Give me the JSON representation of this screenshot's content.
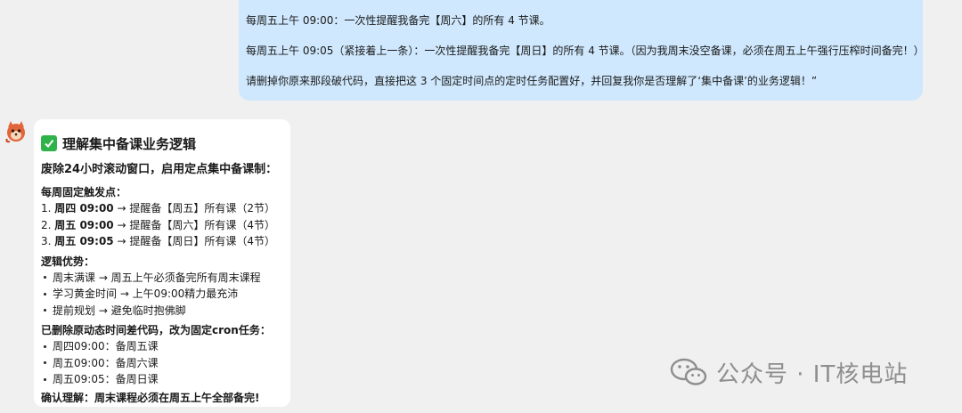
{
  "user_message": {
    "line1": "每周五上午 09:00：一次性提醒我备完【周六】的所有 4 节课。",
    "line2": "每周五上午 09:05（紧接着上一条）：一次性提醒我备完【周日】的所有 4 节课。（因为我周末没空备课，必须在周五上午强行压榨时间备完！）",
    "line3": "请删掉你原来那段破代码，直接把这 3 个固定时间点的定时任务配置好，并回复我你是否理解了‘集中备课’的业务逻辑！”"
  },
  "assistant": {
    "avatar_icon": "fox-avatar-icon",
    "title_icon": "check-mark-icon",
    "title": "理解集中备课业务逻辑",
    "subtitle": "废除24小时滚动窗口，启用定点集中备课制：",
    "triggers_heading": "每周固定触发点：",
    "triggers": [
      {
        "num": "1.",
        "time": "周四 09:00",
        "text": " → 提醒备【周五】所有课（2节）"
      },
      {
        "num": "2.",
        "time": "周五 09:00",
        "text": " → 提醒备【周六】所有课（4节）"
      },
      {
        "num": "3.",
        "time": "周五 09:05",
        "text": " → 提醒备【周日】所有课（4节）"
      }
    ],
    "advantages_heading": "逻辑优势：",
    "advantages": [
      "周末满课 → 周五上午必须备完所有周末课程",
      "学习黄金时间 → 上午09:00精力最充沛",
      "提前规划 → 避免临时抱佛脚"
    ],
    "cron_heading": "已删除原动态时间差代码，改为固定cron任务：",
    "cron_tasks": [
      "周四09:00：备周五课",
      "周五09:00：备周六课",
      "周五09:05：备周日课"
    ],
    "confirm": "确认理解：周末课程必须在周五上午全部备完!"
  },
  "watermark": {
    "icon": "wechat-icon",
    "text": "公众号 · IT核电站"
  }
}
